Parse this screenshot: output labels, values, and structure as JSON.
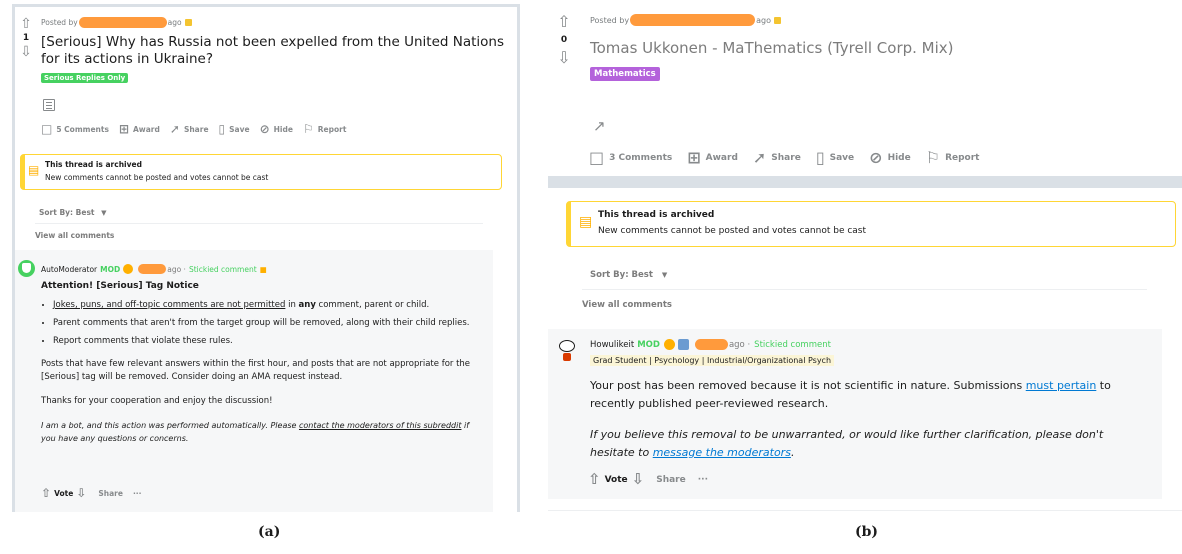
{
  "post_a": {
    "meta_prefix": "Posted by",
    "meta_suffix": "ago",
    "score": "1",
    "title": "[Serious] Why has Russia not been expelled from the United Nations for its actions in Ukraine?",
    "flair": "Serious Replies Only",
    "flair_color": "#46d160",
    "actions": {
      "comments": "5 Comments",
      "award": "Award",
      "share": "Share",
      "save": "Save",
      "hide": "Hide",
      "report": "Report"
    },
    "archived": {
      "title": "This thread is archived",
      "subtitle": "New comments cannot be posted and votes cannot be cast"
    },
    "sort_label": "Sort By: Best",
    "view_all": "View all comments",
    "comment": {
      "author": "AutoModerator",
      "mod": "MOD",
      "time_suffix": "ago ·",
      "stickied": "Stickied comment",
      "heading": "Attention! [Serious] Tag Notice",
      "bullet1_link": "Jokes, puns, and off-topic comments are not permitted",
      "bullet1_mid": " in ",
      "bullet1_bold": "any",
      "bullet1_end": " comment, parent or child.",
      "bullet2": "Parent comments that aren't from the target group will be removed, along with their child replies.",
      "bullet3": "Report comments that violate these rules.",
      "para1": "Posts that have few relevant answers within the first hour, and posts that are not appropriate for the [Serious] tag will be removed. Consider doing an AMA request instead.",
      "para2": "Thanks for your cooperation and enjoy the discussion!",
      "bot_start": "I am a bot, and this action was performed automatically. Please ",
      "bot_link": "contact the moderators of this subreddit",
      "bot_end": " if you have any questions or concerns.",
      "vote": "Vote",
      "share": "Share",
      "more": "···"
    }
  },
  "post_b": {
    "meta_prefix": "Posted by",
    "meta_suffix": "ago",
    "score": "0",
    "title": "Tomas Ukkonen - MaThematics (Tyrell Corp. Mix)",
    "flair": "Mathematics",
    "flair_color": "#b462db",
    "actions": {
      "comments": "3 Comments",
      "award": "Award",
      "share": "Share",
      "save": "Save",
      "hide": "Hide",
      "report": "Report"
    },
    "archived": {
      "title": "This thread is archived",
      "subtitle": "New comments cannot be posted and votes cannot be cast"
    },
    "sort_label": "Sort By: Best",
    "view_all": "View all comments",
    "comment": {
      "author": "Howulikeit",
      "mod": "MOD",
      "time_suffix": "ago ·",
      "stickied": "Stickied comment",
      "user_flair": "Grad Student | Psychology | Industrial/Organizational Psych",
      "para1_start": "Your post has been removed because it is not scientific in nature. Submissions ",
      "para1_link": "must pertain",
      "para1_end": " to recently published peer-reviewed research.",
      "para2_start": "If you believe this removal to be unwarranted, or would like further clarification, please don't hesitate to ",
      "para2_link": "message the moderators",
      "para2_end": ".",
      "vote": "Vote",
      "share": "Share",
      "more": "···"
    }
  },
  "captions": {
    "a": "(a)",
    "b": "(b)"
  }
}
